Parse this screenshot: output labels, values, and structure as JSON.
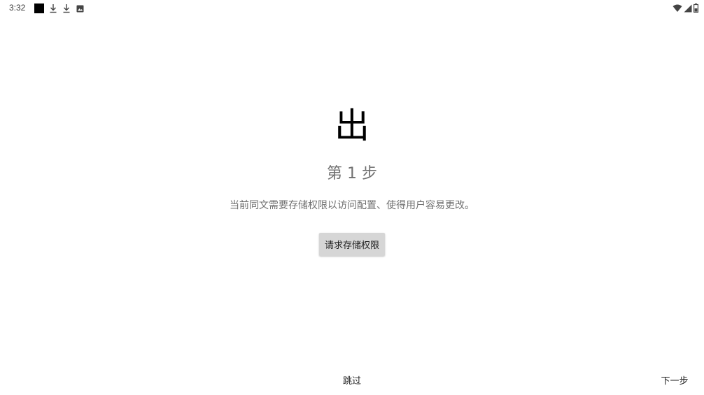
{
  "status_bar": {
    "time": "3:32",
    "left_icons": [
      "black-square-icon",
      "download-icon",
      "download-icon",
      "image-icon"
    ],
    "right_icons": [
      "wifi-icon",
      "signal-icon",
      "battery-icon"
    ]
  },
  "onboarding": {
    "logo_glyph": "出",
    "step_title": "第 1 步",
    "description": "当前同文需要存储权限以访问配置、使得用户容易更改。",
    "permission_button_label": "请求存储权限"
  },
  "navigation": {
    "skip_label": "跳过",
    "next_label": "下一步"
  },
  "colors": {
    "background": "#ffffff",
    "button_gray": "#d6d6d6",
    "secondary_text": "#6f6f6f"
  }
}
